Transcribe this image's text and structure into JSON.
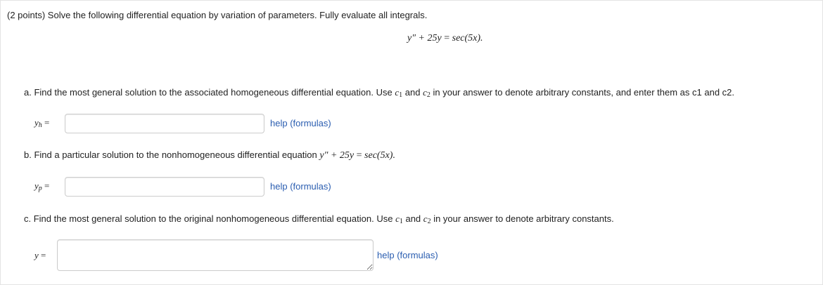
{
  "problem": {
    "intro": "(2 points) Solve the following differential equation by variation of parameters. Fully evaluate all integrals.",
    "equation": {
      "lhs": "y″ + 25y",
      "eq": "=",
      "rhs": "sec(5x)."
    }
  },
  "part_a": {
    "prompt_before": "a. Find the most general solution to the associated homogeneous differential equation. Use",
    "c1": "c",
    "c1_sub": "1",
    "and": "and",
    "c2": "c",
    "c2_sub": "2",
    "prompt_after": "in your answer to denote arbitrary constants, and enter them as c1 and c2.",
    "label": "y",
    "label_sub": "h",
    "label_eq": "=",
    "input_value": "",
    "help_label": "help (formulas)"
  },
  "part_b": {
    "prompt": "b. Find a particular solution to the nonhomogeneous differential equation",
    "eq_lhs": "y″ + 25y",
    "eq_sign": "=",
    "eq_rhs": "sec(5x).",
    "label": "y",
    "label_sub": "p",
    "label_eq": "=",
    "input_value": "",
    "help_label": "help (formulas)"
  },
  "part_c": {
    "prompt_before": "c. Find the most general solution to the original nonhomogeneous differential equation. Use",
    "c1": "c",
    "c1_sub": "1",
    "and": "and",
    "c2": "c",
    "c2_sub": "2",
    "prompt_after": "in your answer to denote arbitrary constants.",
    "label": "y",
    "label_eq": "=",
    "input_value": "",
    "help_label": "help (formulas)"
  }
}
